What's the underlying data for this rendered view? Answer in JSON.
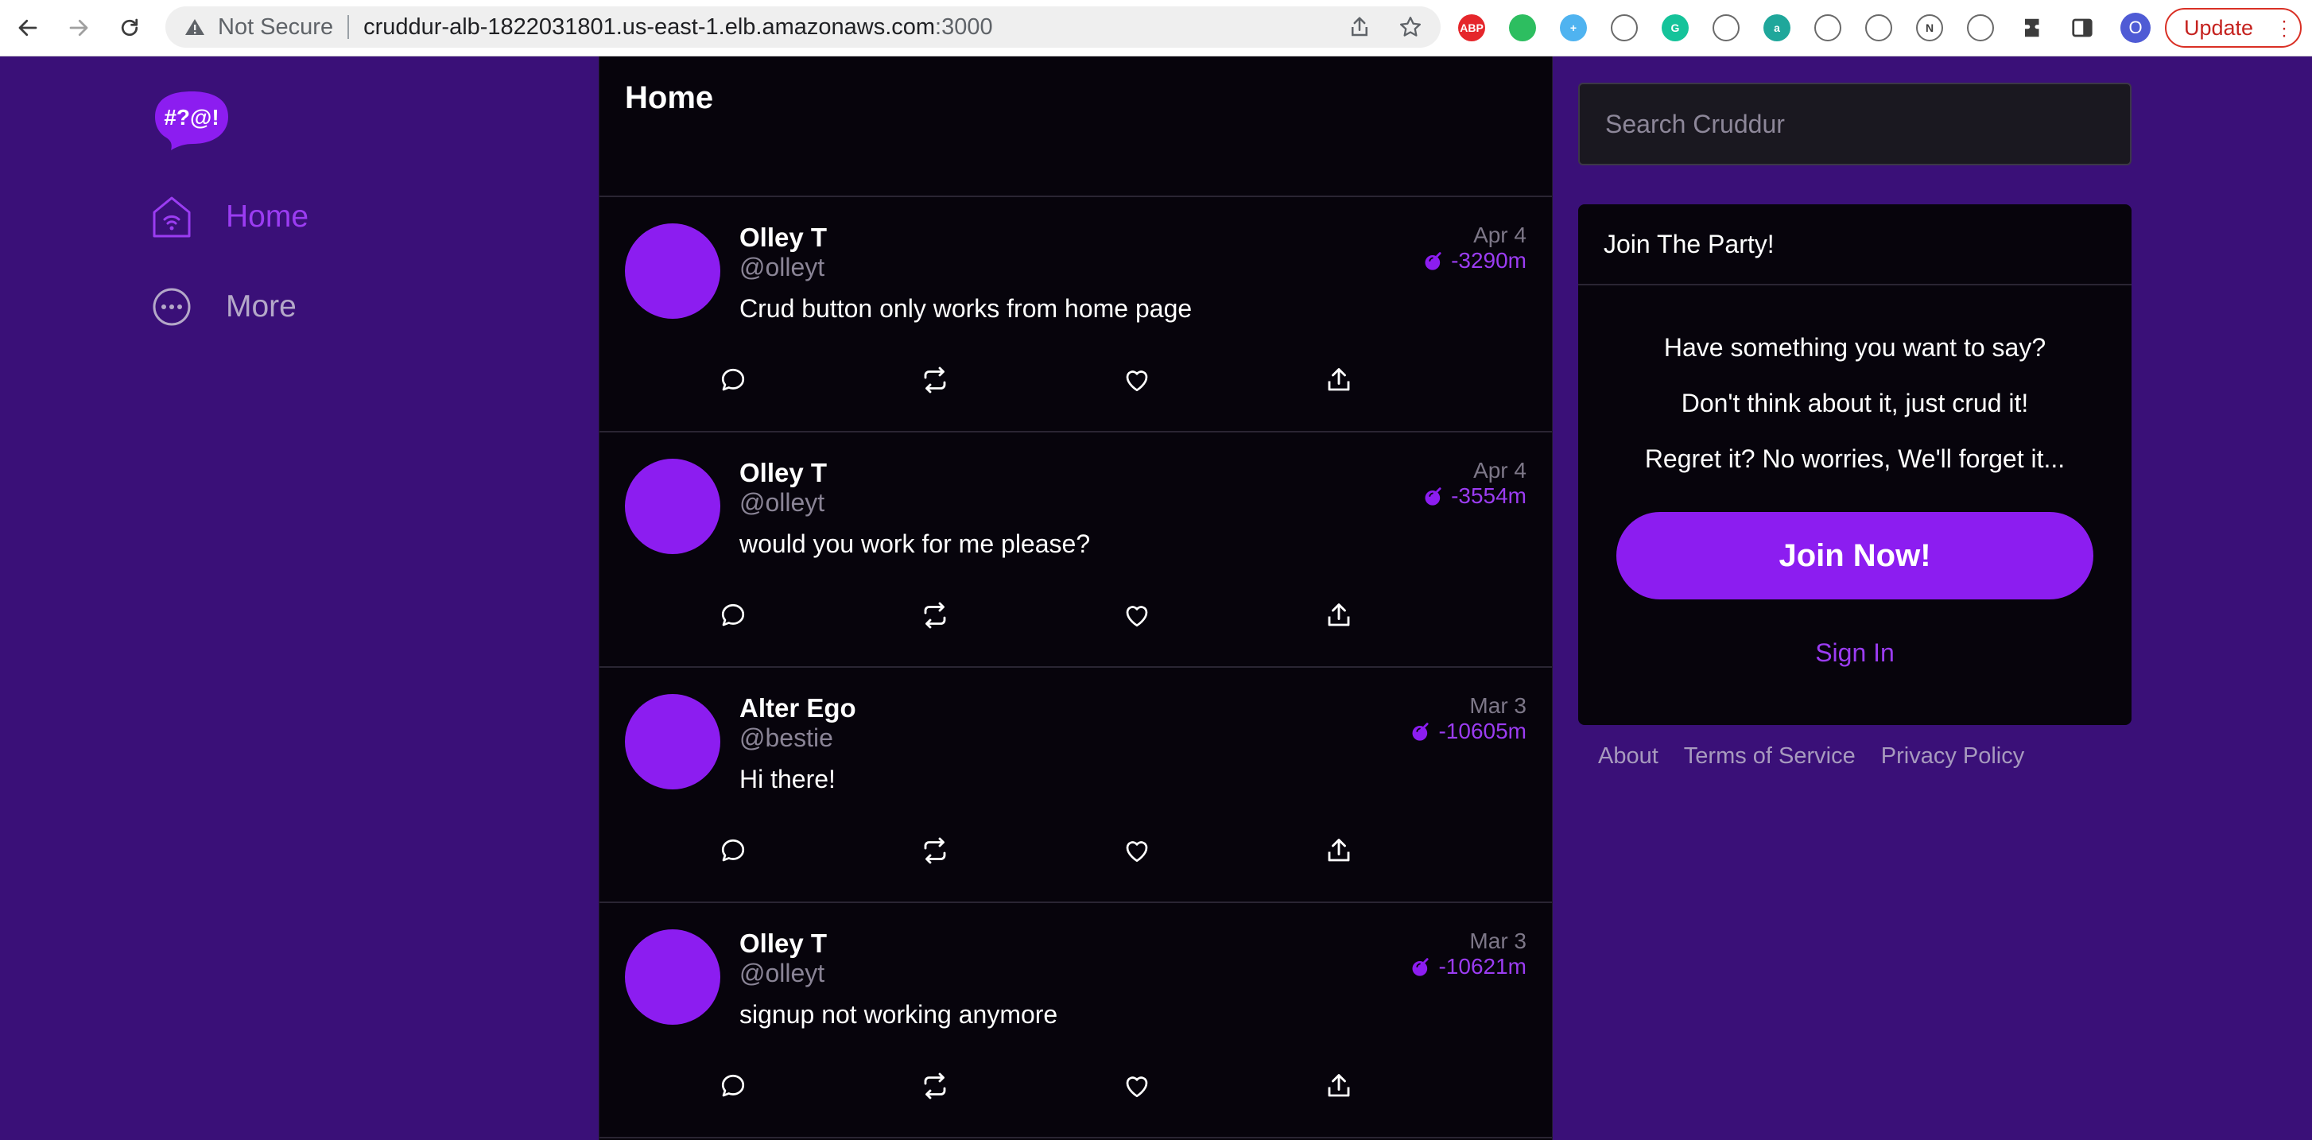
{
  "browser": {
    "not_secure": "Not Secure",
    "url_host": "cruddur-alb-1822031801.us-east-1.elb.amazonaws.com",
    "url_port": ":3000",
    "update_label": "Update",
    "profile_initial": "O",
    "extensions": [
      {
        "name": "adblock-plus-icon",
        "text": "ABP",
        "color": "#e5262b"
      },
      {
        "name": "evernote-icon",
        "text": "",
        "color": "#2dbe60"
      },
      {
        "name": "plus-extension-icon",
        "text": "+",
        "color": "#4fb3f0"
      },
      {
        "name": "eraser-icon",
        "text": "",
        "color": "#ffffff"
      },
      {
        "name": "grammarly-icon",
        "text": "G",
        "color": "#15c39a"
      },
      {
        "name": "quill-icon",
        "text": "",
        "color": "#ffffff"
      },
      {
        "name": "amazon-assistant-icon",
        "text": "a",
        "color": "#1fa79b"
      },
      {
        "name": "printer-icon",
        "text": "",
        "color": "#ffffff"
      },
      {
        "name": "aperture-icon",
        "text": "",
        "color": "#ffffff"
      },
      {
        "name": "notion-icon",
        "text": "N",
        "color": "#ffffff"
      },
      {
        "name": "send-icon",
        "text": "",
        "color": "#ffffff"
      }
    ]
  },
  "sidebar": {
    "logo_text": "#?@!",
    "items": [
      {
        "label": "Home",
        "active": true
      },
      {
        "label": "More",
        "active": false
      }
    ]
  },
  "feed": {
    "title": "Home",
    "posts": [
      {
        "name": "Olley T",
        "handle": "@olleyt",
        "text": "Crud button only works from home page",
        "date": "Apr 4",
        "expires": "-3290m"
      },
      {
        "name": "Olley T",
        "handle": "@olleyt",
        "text": "would you work for me please?",
        "date": "Apr 4",
        "expires": "-3554m"
      },
      {
        "name": "Alter Ego",
        "handle": "@bestie",
        "text": "Hi there!",
        "date": "Mar 3",
        "expires": "-10605m"
      },
      {
        "name": "Olley T",
        "handle": "@olleyt",
        "text": "signup not working anymore",
        "date": "Mar 3",
        "expires": "-10621m"
      }
    ]
  },
  "search": {
    "placeholder": "Search Cruddur"
  },
  "join": {
    "title": "Join The Party!",
    "lines": [
      "Have something you want to say?",
      "Don't think about it, just crud it!",
      "Regret it? No worries, We'll forget it..."
    ],
    "join_label": "Join Now!",
    "signin_label": "Sign In"
  },
  "footer": {
    "links": [
      "About",
      "Terms of Service",
      "Privacy Policy"
    ]
  },
  "colors": {
    "page_bg": "#3a1078",
    "accent": "#8c1df0",
    "feed_bg": "#07040c"
  }
}
